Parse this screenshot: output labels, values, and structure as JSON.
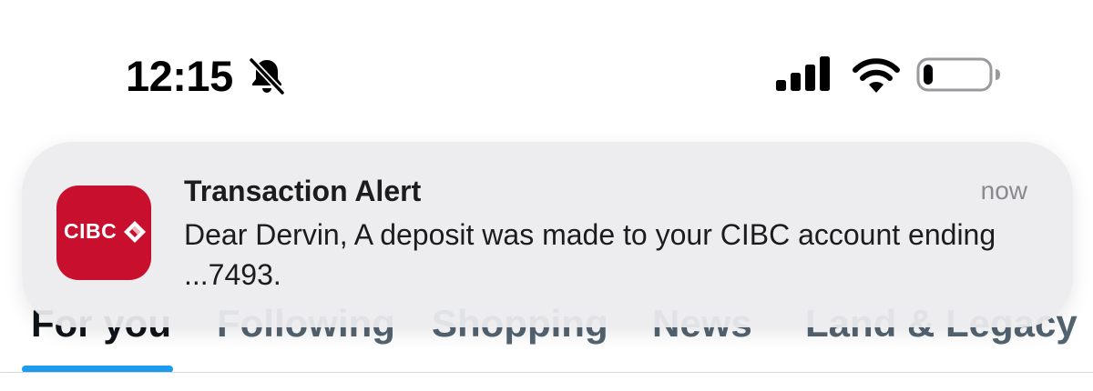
{
  "status_bar": {
    "time": "12:15",
    "icons": [
      "bell-slash-icon",
      "cellular-signal-icon",
      "wifi-icon",
      "battery-icon"
    ],
    "battery_level": 0.15
  },
  "tabs": [
    {
      "label": "For you",
      "active": true
    },
    {
      "label": "Following",
      "active": false
    },
    {
      "label": "Shopping",
      "active": false
    },
    {
      "label": "News",
      "active": false
    },
    {
      "label": "Land & Legacy",
      "active": false
    }
  ],
  "notification": {
    "app_name": "CIBC",
    "title": "Transaction Alert",
    "time": "now",
    "body": "Dear Dervin, A deposit was made to your CIBC account ending ...7493."
  },
  "colors": {
    "brand_red": "#c8102e",
    "tab_accent": "#1d9bf0",
    "notification_bg": "#ececee"
  }
}
